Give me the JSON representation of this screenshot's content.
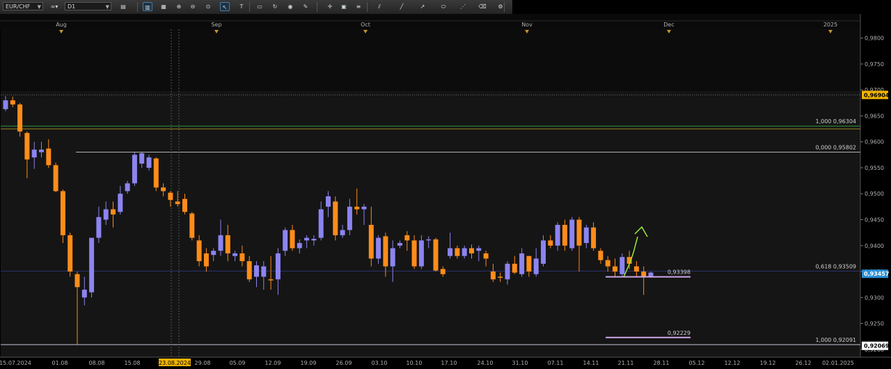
{
  "toolbar": {
    "symbol": "EUR/CHF",
    "timeframe": "D1",
    "buttons": [
      "chart-type-icon",
      "bar-chart-icon",
      "candle-chart-icon",
      "zoom-in-icon",
      "zoom-out-icon",
      "zoom-fit-icon",
      "cursor-icon",
      "text-tool-icon",
      "template-icon",
      "refresh-icon",
      "globe-icon",
      "pencil-icon",
      "crosshair-icon",
      "window-icon",
      "fibonacci-icon",
      "channel-icon",
      "trendline-icon",
      "arrow-icon",
      "ellipse-icon",
      "fan-icon",
      "eraser-icon",
      "settings-icon"
    ]
  },
  "chart_data": {
    "type": "candlestick",
    "symbol": "EUR/CHF",
    "timeframe": "D1",
    "y_range": [
      0.9185,
      0.9817
    ],
    "y_ticks": [
      "0,9800",
      "0,9750",
      "0,9700",
      "0,9650",
      "0,9600",
      "0,9550",
      "0,9500",
      "0,9450",
      "0,9400",
      "0,9350",
      "0,9300",
      "0,9250",
      "0,9200"
    ],
    "month_labels": [
      "Aug",
      "Sep",
      "Oct",
      "Nov",
      "Dec",
      "2025"
    ],
    "date_labels": [
      "15.07.2024",
      "01.08",
      "08.08",
      "15.08",
      "23.08.2024",
      "29.08",
      "05.09",
      "12.09",
      "19.09",
      "26.09",
      "03.10",
      "10.10",
      "17.10",
      "24.10",
      "31.10",
      "07.11",
      "14.11",
      "21.11",
      "28.11",
      "05.12",
      "12.12",
      "19.12",
      "26.12",
      "02.01.2025"
    ],
    "candles": [
      {
        "o": 0.9663,
        "h": 0.9688,
        "l": 0.9659,
        "c": 0.968
      },
      {
        "o": 0.968,
        "h": 0.9687,
        "l": 0.9667,
        "c": 0.9672
      },
      {
        "o": 0.9672,
        "h": 0.9675,
        "l": 0.961,
        "c": 0.962
      },
      {
        "o": 0.9617,
        "h": 0.962,
        "l": 0.953,
        "c": 0.9566
      },
      {
        "o": 0.957,
        "h": 0.96,
        "l": 0.9548,
        "c": 0.9585
      },
      {
        "o": 0.958,
        "h": 0.96,
        "l": 0.957,
        "c": 0.9585
      },
      {
        "o": 0.9587,
        "h": 0.9605,
        "l": 0.955,
        "c": 0.9555
      },
      {
        "o": 0.9555,
        "h": 0.956,
        "l": 0.9503,
        "c": 0.9505
      },
      {
        "o": 0.9505,
        "h": 0.9508,
        "l": 0.9405,
        "c": 0.942
      },
      {
        "o": 0.942,
        "h": 0.9425,
        "l": 0.934,
        "c": 0.935
      },
      {
        "o": 0.9345,
        "h": 0.935,
        "l": 0.921,
        "c": 0.932
      },
      {
        "o": 0.93,
        "h": 0.934,
        "l": 0.9285,
        "c": 0.9315
      },
      {
        "o": 0.931,
        "h": 0.937,
        "l": 0.93,
        "c": 0.9415
      },
      {
        "o": 0.9415,
        "h": 0.9475,
        "l": 0.9405,
        "c": 0.9455
      },
      {
        "o": 0.945,
        "h": 0.9485,
        "l": 0.944,
        "c": 0.947
      },
      {
        "o": 0.947,
        "h": 0.9485,
        "l": 0.9435,
        "c": 0.946
      },
      {
        "o": 0.9465,
        "h": 0.9515,
        "l": 0.946,
        "c": 0.95
      },
      {
        "o": 0.9505,
        "h": 0.9525,
        "l": 0.95,
        "c": 0.952
      },
      {
        "o": 0.952,
        "h": 0.958,
        "l": 0.9515,
        "c": 0.9575
      },
      {
        "o": 0.9558,
        "h": 0.958,
        "l": 0.955,
        "c": 0.9578
      },
      {
        "o": 0.955,
        "h": 0.9575,
        "l": 0.9545,
        "c": 0.957
      },
      {
        "o": 0.9568,
        "h": 0.957,
        "l": 0.9505,
        "c": 0.9512
      },
      {
        "o": 0.9512,
        "h": 0.952,
        "l": 0.9495,
        "c": 0.9505
      },
      {
        "o": 0.9502,
        "h": 0.9505,
        "l": 0.9475,
        "c": 0.9488
      },
      {
        "o": 0.9485,
        "h": 0.9505,
        "l": 0.9475,
        "c": 0.948
      },
      {
        "o": 0.949,
        "h": 0.95,
        "l": 0.946,
        "c": 0.9465
      },
      {
        "o": 0.9462,
        "h": 0.9465,
        "l": 0.941,
        "c": 0.9415
      },
      {
        "o": 0.941,
        "h": 0.942,
        "l": 0.936,
        "c": 0.937
      },
      {
        "o": 0.9385,
        "h": 0.9395,
        "l": 0.935,
        "c": 0.936
      },
      {
        "o": 0.9382,
        "h": 0.9395,
        "l": 0.937,
        "c": 0.939
      },
      {
        "o": 0.939,
        "h": 0.945,
        "l": 0.938,
        "c": 0.942
      },
      {
        "o": 0.942,
        "h": 0.944,
        "l": 0.937,
        "c": 0.9385
      },
      {
        "o": 0.938,
        "h": 0.939,
        "l": 0.937,
        "c": 0.9385
      },
      {
        "o": 0.9385,
        "h": 0.94,
        "l": 0.936,
        "c": 0.937
      },
      {
        "o": 0.937,
        "h": 0.938,
        "l": 0.933,
        "c": 0.9335
      },
      {
        "o": 0.934,
        "h": 0.937,
        "l": 0.932,
        "c": 0.9362
      },
      {
        "o": 0.934,
        "h": 0.937,
        "l": 0.9315,
        "c": 0.936
      },
      {
        "o": 0.9335,
        "h": 0.938,
        "l": 0.9315,
        "c": 0.9333
      },
      {
        "o": 0.9335,
        "h": 0.9395,
        "l": 0.9305,
        "c": 0.9385
      },
      {
        "o": 0.939,
        "h": 0.9435,
        "l": 0.938,
        "c": 0.943
      },
      {
        "o": 0.943,
        "h": 0.944,
        "l": 0.939,
        "c": 0.9395
      },
      {
        "o": 0.9395,
        "h": 0.9412,
        "l": 0.9385,
        "c": 0.9405
      },
      {
        "o": 0.941,
        "h": 0.942,
        "l": 0.9395,
        "c": 0.9415
      },
      {
        "o": 0.941,
        "h": 0.942,
        "l": 0.94,
        "c": 0.9413
      },
      {
        "o": 0.9415,
        "h": 0.9485,
        "l": 0.941,
        "c": 0.947
      },
      {
        "o": 0.9475,
        "h": 0.9505,
        "l": 0.9455,
        "c": 0.9495
      },
      {
        "o": 0.9485,
        "h": 0.9495,
        "l": 0.941,
        "c": 0.942
      },
      {
        "o": 0.942,
        "h": 0.944,
        "l": 0.9415,
        "c": 0.943
      },
      {
        "o": 0.943,
        "h": 0.949,
        "l": 0.942,
        "c": 0.9475
      },
      {
        "o": 0.9475,
        "h": 0.951,
        "l": 0.946,
        "c": 0.947
      },
      {
        "o": 0.947,
        "h": 0.948,
        "l": 0.944,
        "c": 0.9475
      },
      {
        "o": 0.944,
        "h": 0.9475,
        "l": 0.936,
        "c": 0.9375
      },
      {
        "o": 0.9375,
        "h": 0.942,
        "l": 0.9365,
        "c": 0.9415
      },
      {
        "o": 0.9418,
        "h": 0.9425,
        "l": 0.934,
        "c": 0.936
      },
      {
        "o": 0.936,
        "h": 0.941,
        "l": 0.933,
        "c": 0.9395
      },
      {
        "o": 0.94,
        "h": 0.941,
        "l": 0.9395,
        "c": 0.9405
      },
      {
        "o": 0.942,
        "h": 0.9428,
        "l": 0.939,
        "c": 0.941
      },
      {
        "o": 0.941,
        "h": 0.942,
        "l": 0.9355,
        "c": 0.936
      },
      {
        "o": 0.936,
        "h": 0.942,
        "l": 0.9355,
        "c": 0.941
      },
      {
        "o": 0.941,
        "h": 0.9418,
        "l": 0.9395,
        "c": 0.9412
      },
      {
        "o": 0.9412,
        "h": 0.9415,
        "l": 0.935,
        "c": 0.9352
      },
      {
        "o": 0.9355,
        "h": 0.936,
        "l": 0.934,
        "c": 0.9345
      },
      {
        "o": 0.938,
        "h": 0.9425,
        "l": 0.9375,
        "c": 0.9395
      },
      {
        "o": 0.9395,
        "h": 0.94,
        "l": 0.9375,
        "c": 0.938
      },
      {
        "o": 0.938,
        "h": 0.94,
        "l": 0.9375,
        "c": 0.9395
      },
      {
        "o": 0.9395,
        "h": 0.9402,
        "l": 0.9375,
        "c": 0.9385
      },
      {
        "o": 0.939,
        "h": 0.94,
        "l": 0.937,
        "c": 0.9395
      },
      {
        "o": 0.9385,
        "h": 0.939,
        "l": 0.936,
        "c": 0.9375
      },
      {
        "o": 0.935,
        "h": 0.9365,
        "l": 0.933,
        "c": 0.9335
      },
      {
        "o": 0.934,
        "h": 0.9348,
        "l": 0.933,
        "c": 0.9338
      },
      {
        "o": 0.9335,
        "h": 0.937,
        "l": 0.9325,
        "c": 0.9365
      },
      {
        "o": 0.9365,
        "h": 0.938,
        "l": 0.9345,
        "c": 0.9348
      },
      {
        "o": 0.9345,
        "h": 0.9395,
        "l": 0.934,
        "c": 0.9385
      },
      {
        "o": 0.938,
        "h": 0.938,
        "l": 0.934,
        "c": 0.935
      },
      {
        "o": 0.9345,
        "h": 0.9395,
        "l": 0.934,
        "c": 0.9375
      },
      {
        "o": 0.9365,
        "h": 0.942,
        "l": 0.936,
        "c": 0.941
      },
      {
        "o": 0.941,
        "h": 0.942,
        "l": 0.9395,
        "c": 0.94
      },
      {
        "o": 0.94,
        "h": 0.9445,
        "l": 0.939,
        "c": 0.944
      },
      {
        "o": 0.944,
        "h": 0.945,
        "l": 0.939,
        "c": 0.94
      },
      {
        "o": 0.9395,
        "h": 0.9455,
        "l": 0.939,
        "c": 0.945
      },
      {
        "o": 0.945,
        "h": 0.9455,
        "l": 0.935,
        "c": 0.94
      },
      {
        "o": 0.9405,
        "h": 0.944,
        "l": 0.9395,
        "c": 0.9435
      },
      {
        "o": 0.9435,
        "h": 0.9445,
        "l": 0.939,
        "c": 0.9395
      },
      {
        "o": 0.939,
        "h": 0.9395,
        "l": 0.9365,
        "c": 0.9372
      },
      {
        "o": 0.9372,
        "h": 0.938,
        "l": 0.935,
        "c": 0.936
      },
      {
        "o": 0.936,
        "h": 0.9375,
        "l": 0.934,
        "c": 0.935
      },
      {
        "o": 0.9345,
        "h": 0.9385,
        "l": 0.934,
        "c": 0.9378
      },
      {
        "o": 0.9378,
        "h": 0.939,
        "l": 0.9355,
        "c": 0.9365
      },
      {
        "o": 0.936,
        "h": 0.937,
        "l": 0.934,
        "c": 0.935
      },
      {
        "o": 0.935,
        "h": 0.936,
        "l": 0.9305,
        "c": 0.934
      },
      {
        "o": 0.934,
        "h": 0.935,
        "l": 0.9338,
        "c": 0.9348
      }
    ],
    "horizontal_lines": [
      {
        "value": 0.96904,
        "color": "#666666",
        "style": "dotted"
      },
      {
        "value": 0.96304,
        "color": "#2e9e3e",
        "style": "solid"
      },
      {
        "value": 0.9625,
        "color": "#9a8a20",
        "style": "solid"
      },
      {
        "value": 0.93509,
        "color": "#2c3570",
        "style": "solid"
      },
      {
        "value": 0.92091,
        "color": "#c8c8d8",
        "style": "solid"
      }
    ],
    "fib_labels": [
      {
        "value": 0.96304,
        "text": "1,000 0,96304"
      },
      {
        "value": 0.95802,
        "text": "0,000 0,95802"
      },
      {
        "value": 0.93509,
        "text": "0,618 0,93509"
      },
      {
        "value": 0.92091,
        "text": "1,000 0,92091"
      }
    ],
    "fib_zero_line": {
      "value": 0.95802,
      "color": "#b5b5b5"
    },
    "level_markers": [
      {
        "value": 0.93398,
        "text": "0,93398",
        "color": "#cfa6e6"
      },
      {
        "value": 0.92229,
        "text": "0,92229",
        "color": "#cfa6e6"
      }
    ],
    "price_tags": [
      {
        "value": 0.96904,
        "text": "0,96904",
        "bg": "#f2b400",
        "fg": "#000000"
      },
      {
        "value": 0.93457,
        "text": "0,93457",
        "bg": "#2a8fd6",
        "fg": "#ffffff"
      },
      {
        "value": 0.92069,
        "text": "0,92069",
        "bg": "#ffffff",
        "fg": "#000000"
      }
    ],
    "forecast_arrow": {
      "color": "#9fe83a"
    },
    "colors": {
      "bull": "#8c84f0",
      "bear": "#ff8c1a",
      "axis_text": "#b0b0b0",
      "highlight_date_bg": "#f2b400"
    },
    "highlighted_date": "23.08.2024"
  }
}
